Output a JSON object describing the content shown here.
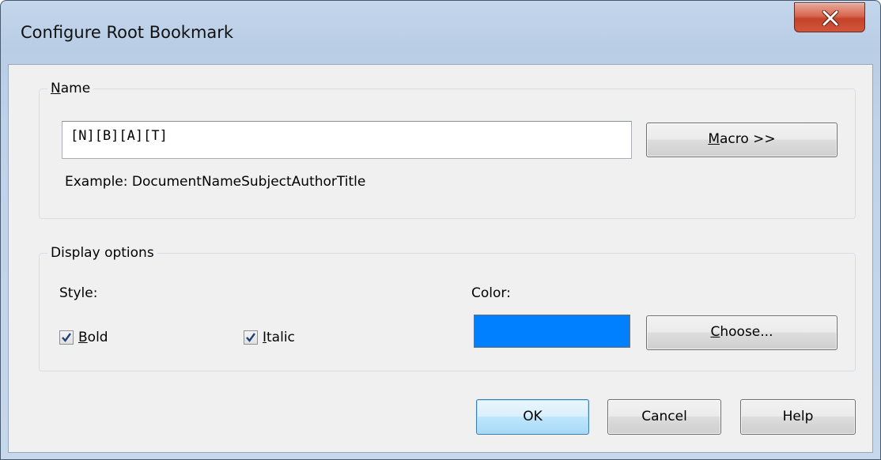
{
  "window": {
    "title": "Configure Root Bookmark"
  },
  "name_group": {
    "label_prefix": "",
    "label_mnemonic": "N",
    "label_rest": "ame",
    "input_value": "[N][B][A][T]",
    "macro_button": {
      "mnemonic": "M",
      "rest": "acro >>"
    },
    "example_text": "Example: DocumentNameSubjectAuthorTitle"
  },
  "display_group": {
    "label": "Display options",
    "style_label": "Style:",
    "bold": {
      "mnemonic": "B",
      "rest": "old",
      "checked": true
    },
    "italic": {
      "mnemonic": "I",
      "rest": "talic",
      "checked": true
    },
    "color_label": "Color:",
    "color_value": "#0080ff",
    "choose_button": {
      "mnemonic": "C",
      "rest": "hoose..."
    }
  },
  "buttons": {
    "ok": "OK",
    "cancel": "Cancel",
    "help": "Help"
  },
  "icons": {
    "close": "close-icon",
    "checkmark": "checkmark-icon"
  }
}
